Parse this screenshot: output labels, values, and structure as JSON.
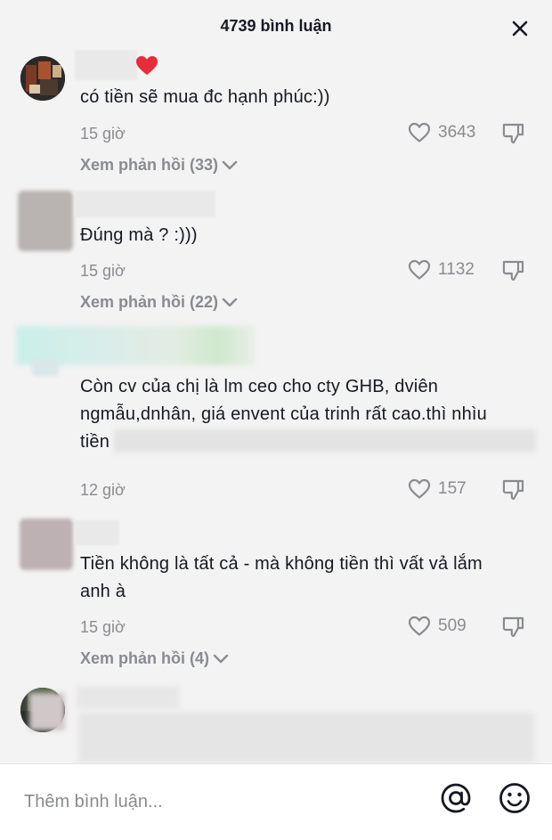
{
  "header": {
    "title": "4739 bình luận"
  },
  "icons": {
    "close": "close-icon",
    "like": "heart-outline-icon",
    "dislike": "thumbs-down-icon",
    "chevron": "chevron-down-icon",
    "mention": "at-sign-icon",
    "emoji": "smile-emoji-icon",
    "name_emoji": "red-heart-emoji"
  },
  "colors": {
    "panel_bg": "#f3f3f3",
    "secondary_text": "#8a8b91",
    "primary_text": "#161823",
    "heart_emoji": "#e52d3c"
  },
  "comments": [
    {
      "text_lines": [
        "có tiền sẽ mua đc hạnh phúc:))"
      ],
      "time": "15 giờ",
      "likes": "3643",
      "replies_label": "Xem phản hồi (33)"
    },
    {
      "text_lines": [
        "Đúng mà ? :)))"
      ],
      "time": "15 giờ",
      "likes": "1132",
      "replies_label": "Xem phản hồi (22)"
    },
    {
      "text_lines": [
        "Còn cv của chị là lm ceo cho cty GHB, dviên",
        "ngmẫu,dnhân, giá envent của trinh rất cao.thì nhìu",
        "tiền"
      ],
      "time": "12 giờ",
      "likes": "157"
    },
    {
      "text_lines": [
        "Tiền không là tất cả - mà không tiền thì vất vả lắm",
        "anh à"
      ],
      "time": "15 giờ",
      "likes": "509",
      "replies_label": "Xem phản hồi (4)"
    }
  ],
  "footer": {
    "placeholder": "Thêm bình luận..."
  }
}
